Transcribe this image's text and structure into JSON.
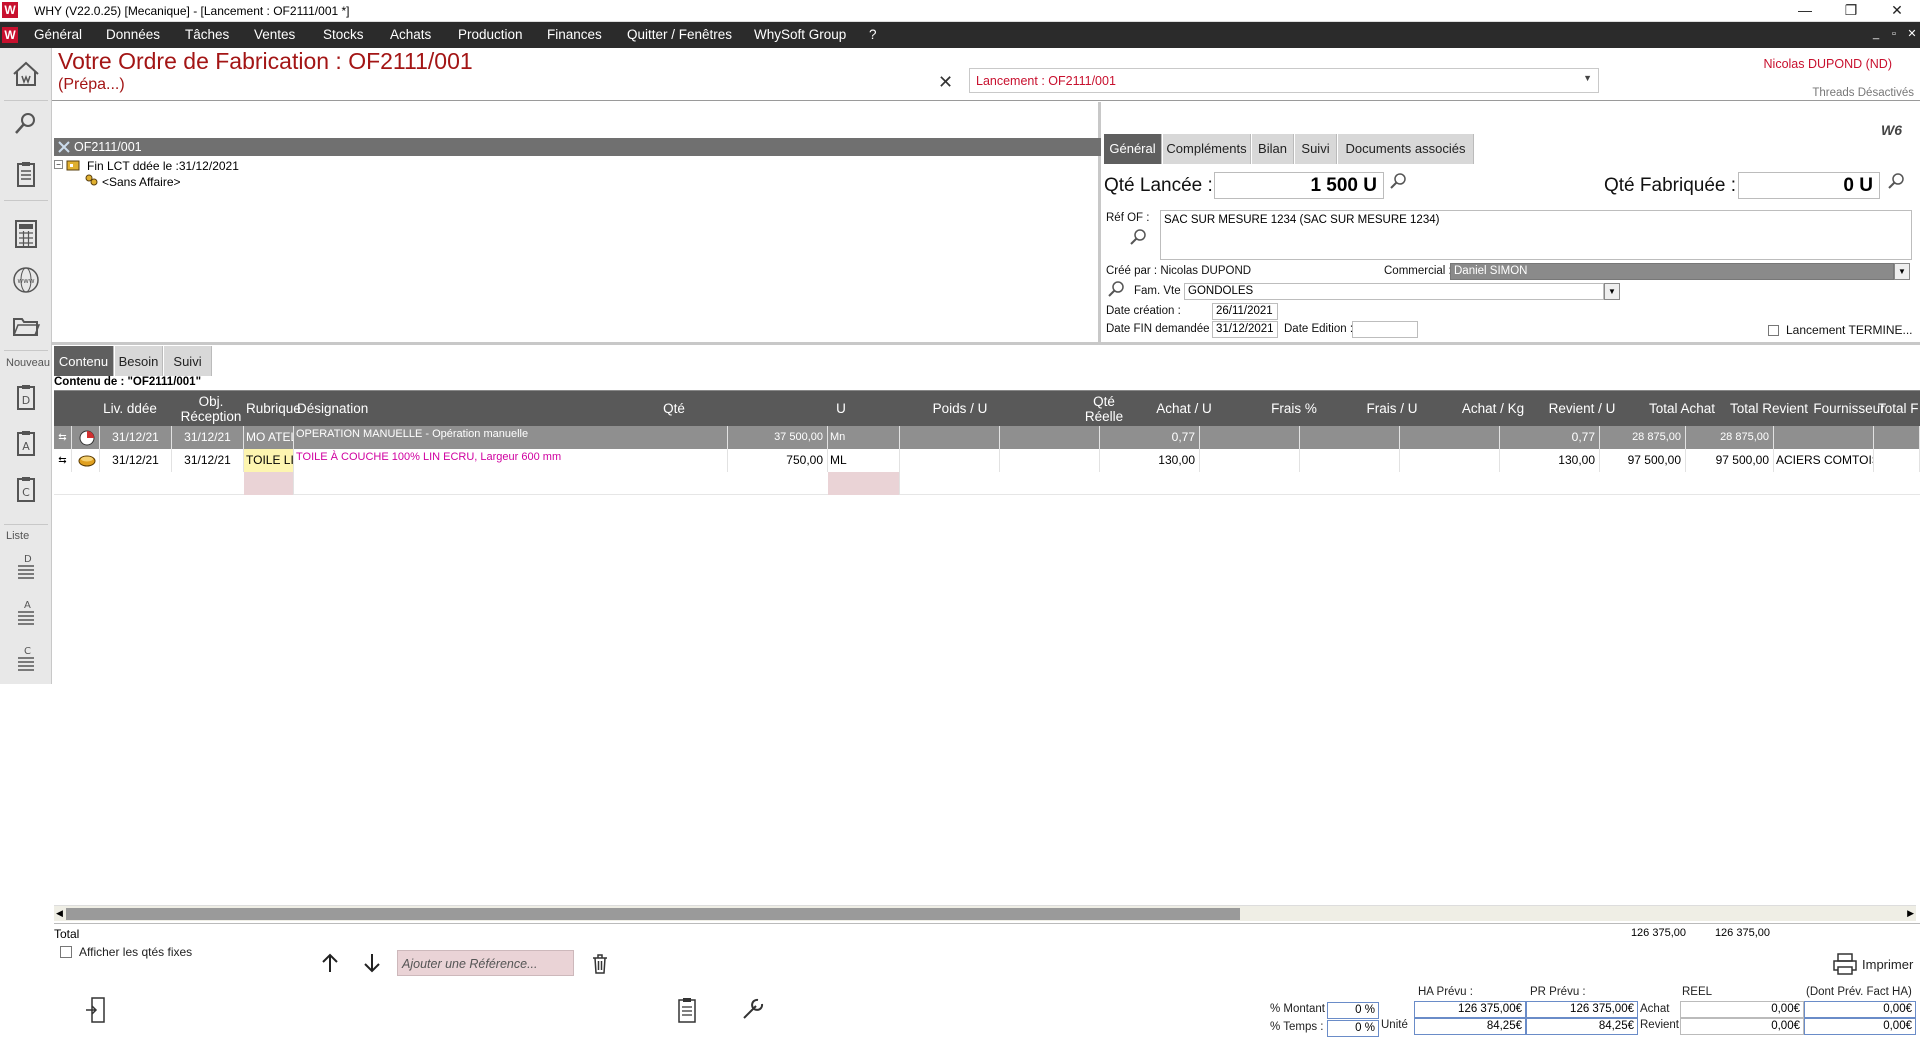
{
  "window": {
    "title": "WHY (V22.0.25)  [Mecanique] - [Lancement : OF2111/001 *]",
    "logo": "W",
    "minimize": "—",
    "restore": "❐",
    "close": "✕"
  },
  "menu": {
    "items": [
      "Général",
      "Données",
      "Tâches",
      "Ventes",
      "Stocks",
      "Achats",
      "Production",
      "Finances",
      "Quitter / Fenêtres",
      "WhySoft Group",
      "?"
    ]
  },
  "sidebar": {
    "nouveau_label": "Nouveau",
    "liste_label": "Liste",
    "doc_letters": [
      "D",
      "A",
      "C"
    ],
    "list_letters": [
      "D",
      "A",
      "C"
    ]
  },
  "header": {
    "title": "Votre Ordre de Fabrication : OF2111/001",
    "subtitle": "(Prépa...)",
    "launch_combo": "Lancement : OF2111/001",
    "user": "Nicolas DUPOND (ND)",
    "threads": "Threads Désactivés"
  },
  "tree": {
    "root": "OF2111/001",
    "child": "Fin LCT ddée le :31/12/2021",
    "grandchild": "<Sans Affaire>"
  },
  "right_panel": {
    "brand_mark": "W6",
    "tabs": [
      "Général",
      "Compléments",
      "Bilan",
      "Suivi",
      "Documents associés"
    ],
    "qte_lancee_label": "Qté Lancée :",
    "qte_lancee_value": "1 500 U",
    "qte_fabriquee_label": "Qté Fabriquée :",
    "qte_fabriquee_value": "0 U",
    "ref_of_label": "Réf OF :",
    "ref_of_value": "SAC SUR MESURE 1234 (SAC SUR MESURE 1234)",
    "cree_par": "Créé par : Nicolas DUPOND",
    "commercial_label": "Commercial :",
    "commercial_value": "Daniel SIMON",
    "fam_vte_label": "Fam. Vte :",
    "fam_vte_value": "GONDOLES",
    "date_creation_label": "Date création :",
    "date_creation_value": "26/11/2021",
    "date_fin_label": "Date FIN demandée :",
    "date_fin_value": "31/12/2021",
    "date_edition_label": "Date Edition :",
    "date_edition_value": "",
    "lancement_termine": "Lancement TERMINE..."
  },
  "content": {
    "tabs": [
      "Contenu",
      "Besoin",
      "Suivi"
    ],
    "label": "Contenu de : \"OF2111/001\"",
    "columns": [
      "Liv. ddée",
      "Obj. Réception",
      "Rubrique",
      "Désignation",
      "Qté",
      "U",
      "Poids / U",
      "Qté Réelle",
      "Achat / U",
      "Frais %",
      "Frais / U",
      "Achat / Kg",
      "Revient / U",
      "Total Achat",
      "Total Revient",
      "Fournisseur",
      "Total F"
    ],
    "rows": [
      {
        "liv": "31/12/21",
        "obj": "31/12/21",
        "rubrique": "MO ATELIER",
        "designation": "OPERATION MANUELLE - Opération manuelle",
        "qte": "37 500,00",
        "u": "Mn",
        "poids": "",
        "qte_reelle": "",
        "achat_u": "0,77",
        "frais_pct": "",
        "frais_u": "",
        "achat_kg": "",
        "revient_u": "0,77",
        "total_achat": "28 875,00",
        "total_revient": "28 875,00",
        "fournisseur": "",
        "total_f": ""
      },
      {
        "liv": "31/12/21",
        "obj": "31/12/21",
        "rubrique": "TOILE LIN",
        "designation": "TOILE À COUCHE 100% LIN ECRU, Largeur 600 mm",
        "qte": "750,00",
        "u": "ML",
        "poids": "",
        "qte_reelle": "",
        "achat_u": "130,00",
        "frais_pct": "",
        "frais_u": "",
        "achat_kg": "",
        "revient_u": "130,00",
        "total_achat": "97 500,00",
        "total_revient": "97 500,00",
        "fournisseur": "ACIERS COMTOIS",
        "total_f": ""
      }
    ],
    "total_label": "Total",
    "total_achat": "126 375,00",
    "total_revient": "126 375,00"
  },
  "bottom": {
    "afficher_qtes": "Afficher les qtés fixes",
    "ajouter_placeholder": "Ajouter une Référence...",
    "imprimer": "Imprimer",
    "pct_montant_label": "% Montant :",
    "pct_montant_value": "0 %",
    "pct_temps_label": "% Temps :",
    "pct_temps_value": "0 %",
    "unite_label": "Unité",
    "ha_prevu_label": "HA Prévu :",
    "pr_prevu_label": "PR Prévu :",
    "reel_label": "REEL",
    "dont_prev_label": "(Dont Prév. Fact HA)",
    "achat_label": "Achat",
    "revient_label": "Revient",
    "ha_prevu_montant": "126 375,00€",
    "ha_prevu_unite": "84,25€",
    "pr_prevu_montant": "126 375,00€",
    "pr_prevu_unite": "84,25€",
    "reel_achat": "0,00€",
    "reel_revient": "0,00€",
    "dont_prev_achat": "0,00€",
    "dont_prev_revient": "0,00€"
  },
  "colors": {
    "accent_red": "#c8102e",
    "menu_bg": "#2b2b2b",
    "header_grey": "#595959",
    "designation_pink": "#d000a0"
  }
}
